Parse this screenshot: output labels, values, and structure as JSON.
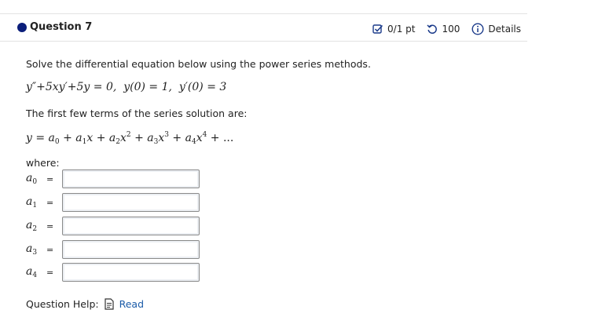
{
  "question": {
    "title": "Question 7",
    "score": "0/1 pt",
    "attempts": "100",
    "details": "Details"
  },
  "prompt": "Solve the differential equation below using the power series methods.",
  "equation": {
    "ode": "y″+5xy′+5y = 0,",
    "ic1": "y(0) = 1,",
    "ic2": "y′(0) = 3"
  },
  "series_intro": "The first few terms of the series solution are:",
  "where_label": "where:",
  "coefficients": [
    {
      "name": "a",
      "sub": "0",
      "eq": "=",
      "value": ""
    },
    {
      "name": "a",
      "sub": "1",
      "eq": "=",
      "value": ""
    },
    {
      "name": "a",
      "sub": "2",
      "eq": "=",
      "value": ""
    },
    {
      "name": "a",
      "sub": "3",
      "eq": "=",
      "value": ""
    },
    {
      "name": "a",
      "sub": "4",
      "eq": "=",
      "value": ""
    }
  ],
  "help": {
    "label": "Question Help:",
    "link": "Read"
  },
  "colors": {
    "bullet": "#0b1e7a",
    "link": "#1a5ba8",
    "icon": "#1a3a8a"
  },
  "icons": [
    "checkbox-score-icon",
    "retry-icon",
    "info-icon",
    "document-icon"
  ]
}
